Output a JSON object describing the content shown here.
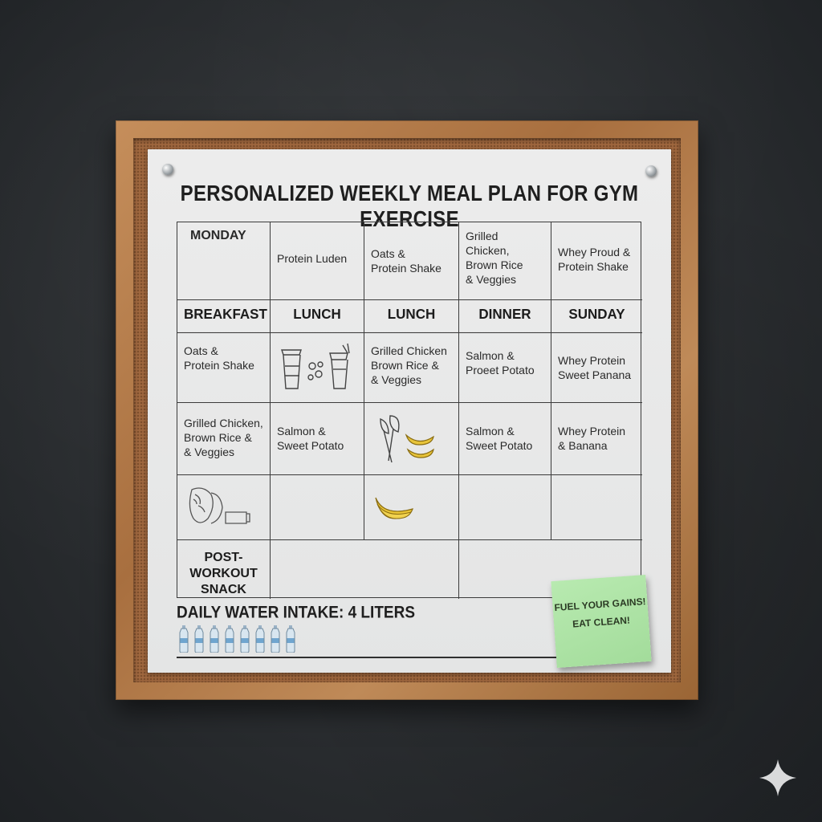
{
  "board": {
    "title": "PERSONALIZED WEEKLY MEAL PLAN FOR GYM EXERCISE",
    "row1": {
      "day": "MONDAY",
      "c2": "Protein Luden",
      "c3": "Oats &\nProtein Shake",
      "c4": "Grilled Chicken,\nBrown Rice\n& Veggies",
      "c5": "Whey Proud &\nProtein Shake"
    },
    "headers": [
      "BREAKFAST",
      "LUNCH",
      "LUNCH",
      "DINNER",
      "SUNDAY"
    ],
    "row3": {
      "c1": "Oats &\nProtein Shake",
      "c3": "Grilled Chicken\nBrown Rice &\n& Veggies",
      "c4": "Salmon &\nProeet Potato",
      "c5": "Whey Protein\nSweet Panana"
    },
    "row4": {
      "c1": "Grilled Chicken,\nBrown Rice &\n& Veggies",
      "c2": "Salmon &\nSweet Potato",
      "c4": "Salmon &\nSweet Potato",
      "c5": "Whey Protein\n& Banana"
    },
    "snack_label": "POST-WORKOUT\nSNACK",
    "water": "DAILY WATER INTAKE: 4 LITERS",
    "bottle_count": 8
  },
  "sticky_note": {
    "line1": "FUEL YOUR GAINS!",
    "line2": "EAT CLEAN!"
  },
  "icons": [
    "shaker-cups-icon",
    "spinach-leaf-icon",
    "banana-icon",
    "chicken-wrap-icon",
    "water-bottle-icon",
    "sparkle-icon"
  ]
}
